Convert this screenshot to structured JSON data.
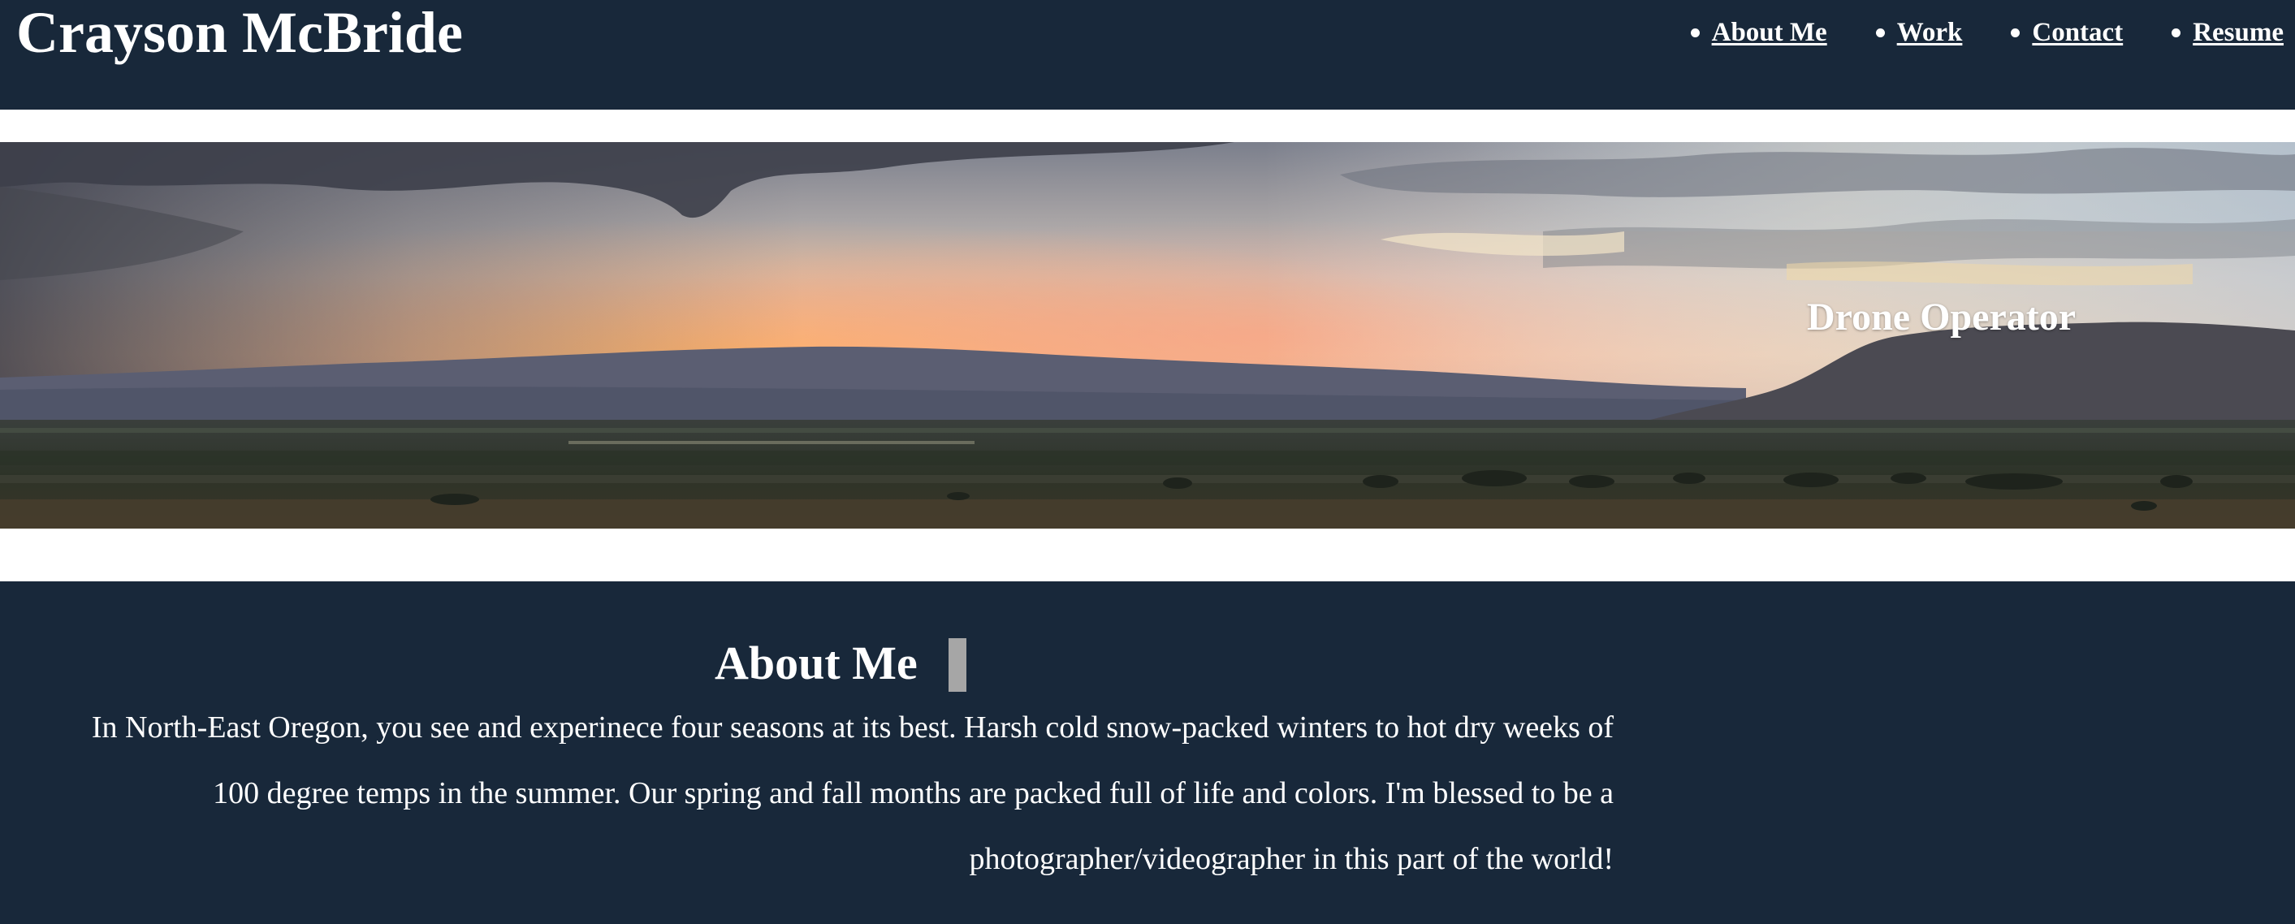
{
  "header": {
    "site_title": "Crayson McBride",
    "nav": [
      {
        "label": "About Me"
      },
      {
        "label": "Work"
      },
      {
        "label": "Contact"
      },
      {
        "label": "Resume"
      }
    ]
  },
  "hero": {
    "caption": "Drone Operator",
    "image_subject": "panoramic sunset over valley and mountains"
  },
  "about": {
    "heading": "About Me",
    "body_lines": [
      "In North-East Oregon, you see and experinece four seasons at its best. Harsh cold snow-packed winters to hot dry weeks of",
      "100 degree temps in the summer. Our spring and fall months are packed full of life and colors. I'm blessed to be a",
      "photographer/videographer in this part of the world!"
    ]
  },
  "colors": {
    "header_bg": "#18283a",
    "section_bg": "#18283a",
    "text": "#ffffff",
    "page_bg": "#ffffff"
  }
}
